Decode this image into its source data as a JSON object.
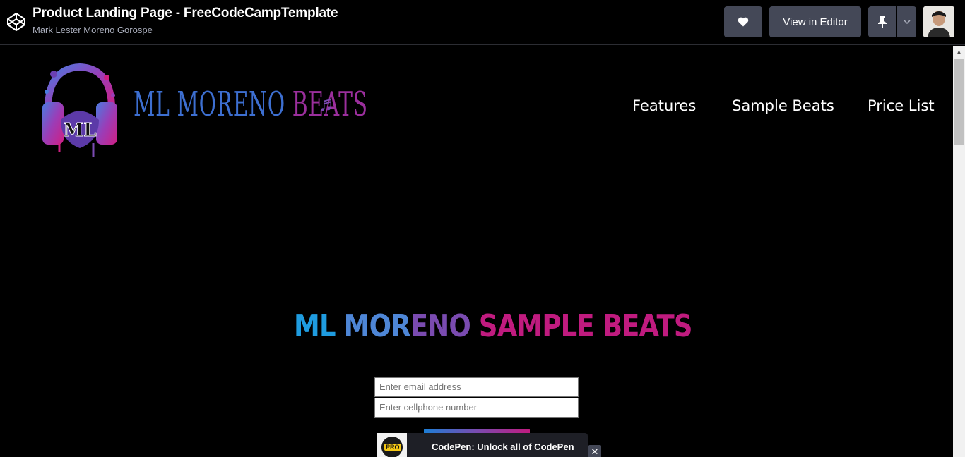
{
  "header": {
    "title": "Product Landing Page - FreeCodeCampTemplate",
    "author": "Mark Lester Moreno Gorospe",
    "view_in_editor": "View in Editor",
    "icons": [
      "codepen-logo-icon",
      "heart-icon",
      "pin-icon",
      "chevron-down-icon"
    ]
  },
  "site": {
    "brand_part1": "ML MORENO ",
    "brand_part2": "BEATS",
    "brand_note": "♬",
    "logo_initials": "ML",
    "nav": [
      "Features",
      "Sample Beats",
      "Price List"
    ]
  },
  "hero": {
    "title_p1": "ML ",
    "title_p2": "MOR",
    "title_p3": "ENO ",
    "title_p4": "SAMPLE BEATS"
  },
  "form": {
    "email_placeholder": "Enter email address",
    "phone_placeholder": "Enter cellphone number"
  },
  "promo": {
    "badge": "PRO",
    "text": "CodePen: Unlock all of CodePen",
    "close": "✕"
  },
  "colors": {
    "header_button": "#444857",
    "accent_blue": "#1f9ce0",
    "accent_purple": "#7a4bb0",
    "accent_pink": "#c01b7f"
  }
}
